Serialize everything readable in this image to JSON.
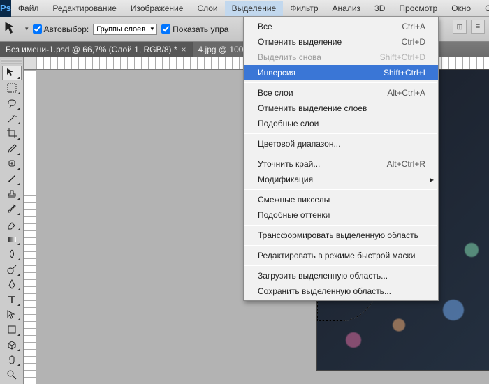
{
  "menubar": {
    "items": [
      "Файл",
      "Редактирование",
      "Изображение",
      "Слои",
      "Выделение",
      "Фильтр",
      "Анализ",
      "3D",
      "Просмотр",
      "Окно",
      "С"
    ]
  },
  "options": {
    "autoselect_label": "Автовыбор:",
    "autoselect_value": "Группы слоев",
    "show_controls_label": "Показать упра"
  },
  "tabs": [
    {
      "label": "Без имени-1.psd @ 66,7% (Слой 1, RGB/8) *"
    },
    {
      "label": "4.jpg @ 100"
    }
  ],
  "dropdown": {
    "items": [
      {
        "label": "Все",
        "shortcut": "Ctrl+A"
      },
      {
        "label": "Отменить выделение",
        "shortcut": "Ctrl+D"
      },
      {
        "label": "Выделить снова",
        "shortcut": "Shift+Ctrl+D",
        "disabled": true
      },
      {
        "label": "Инверсия",
        "shortcut": "Shift+Ctrl+I",
        "hover": true
      },
      {
        "sep": true
      },
      {
        "label": "Все слои",
        "shortcut": "Alt+Ctrl+A"
      },
      {
        "label": "Отменить выделение слоев"
      },
      {
        "label": "Подобные слои"
      },
      {
        "sep": true
      },
      {
        "label": "Цветовой диапазон..."
      },
      {
        "sep": true
      },
      {
        "label": "Уточнить край...",
        "shortcut": "Alt+Ctrl+R"
      },
      {
        "label": "Модификация",
        "submenu": true
      },
      {
        "sep": true
      },
      {
        "label": "Смежные пикселы"
      },
      {
        "label": "Подобные оттенки"
      },
      {
        "sep": true
      },
      {
        "label": "Трансформировать выделенную область"
      },
      {
        "sep": true
      },
      {
        "label": "Редактировать в режиме быстрой маски"
      },
      {
        "sep": true
      },
      {
        "label": "Загрузить выделенную область..."
      },
      {
        "label": "Сохранить выделенную область..."
      }
    ]
  },
  "tools": [
    "move",
    "marquee",
    "lasso",
    "wand",
    "crop",
    "eyedrop",
    "heal",
    "brush",
    "stamp",
    "history",
    "eraser",
    "gradient",
    "blur",
    "dodge",
    "pen",
    "type",
    "path",
    "shape",
    "3d",
    "hand",
    "zoom"
  ]
}
